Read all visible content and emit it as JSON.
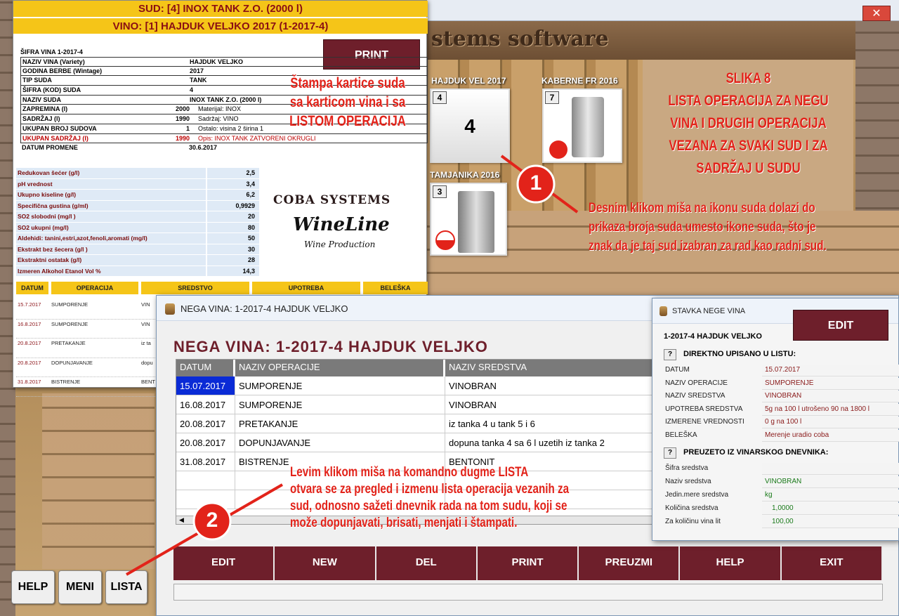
{
  "app": {
    "banner_text": "stems software"
  },
  "tiles": [
    {
      "label": "HAJDUK VEL 2017",
      "number": "4",
      "center_number": "4"
    },
    {
      "label": "KABERNE FR 2016",
      "number": "7"
    },
    {
      "label": "TAMJANIKA  2016",
      "number": "3"
    }
  ],
  "annotation": {
    "slika_title": "SLIKA 8",
    "slika_lines": [
      "LISTA OPERACIJA ZA NEGU",
      "VINA I DRUGIH OPERACIJA",
      "VEZANA ZA SVAKI SUD I ZA",
      "SADRŽAJ U SUDU"
    ],
    "print_note_lines": [
      "Štampa kartice suda",
      "sa karticom vina i sa",
      "LISTOM OPERACIJA"
    ],
    "note1_lines": [
      "Desnim klikom miša na ikonu suda dolazi do",
      "prikaza broja suda umesto ikone suda, što je",
      "znak da je taj sud izabran za rad kao radni sud."
    ],
    "note2_lines": [
      "Levim klikom miša na komandno dugme LISTA",
      "otvara se za pregled i izmenu lista operacija vezanih za",
      "sud, odnosno sažeti dnevnik rada na tom sudu, koji se",
      "može dopunjavati, brisati, menjati i štampati."
    ],
    "marker1": "1",
    "marker2": "2"
  },
  "report": {
    "sud_header": "SUD: [4]  INOX TANK Z.O. (2000 l)",
    "vino_header": "VINO: [1]  HAJDUK VELJKO 2017  (1-2017-4)",
    "sifra_vina": "ŠIFRA VINA 1-2017-4",
    "print_button": "PRINT",
    "rows": [
      {
        "label": "NAZIV VINA (Variety)",
        "value": "HAJDUK VELJKO",
        "extra": ""
      },
      {
        "label": "GODINA BERBE (Wintage)",
        "value": "2017",
        "extra": ""
      },
      {
        "label": "TIP SUDA",
        "value": "TANK",
        "extra": ""
      },
      {
        "label": "ŠIFRA (KOD) SUDA",
        "value": "4",
        "extra": ""
      },
      {
        "label": "NAZIV SUDA",
        "value": "INOX TANK Z.O. (2000 l)",
        "extra": ""
      },
      {
        "label": "ZAPREMINA (l)",
        "value": "2000",
        "extra": "Materijal: INOX"
      },
      {
        "label": "SADRŽAJ (l)",
        "value": "1990",
        "extra": "Sadržaj: VINO"
      },
      {
        "label": "UKUPAN BROJ SUDOVA",
        "value": "1",
        "extra": "Ostalo: visina 2 širina 1"
      },
      {
        "label": "UKUPAN SADRŽAJ (l)",
        "value": "1990",
        "extra": "Opis: INOX TANK ZATVORENI OKRUGLI"
      },
      {
        "label": "DATUM PROMENE",
        "value": "30.6.2017",
        "extra": ""
      }
    ],
    "analysis": [
      {
        "label": "Redukovan šećer (g/l)",
        "value": "2,5"
      },
      {
        "label": "pH vrednost",
        "value": "3,4"
      },
      {
        "label": "Ukupno kiseline (g/l)",
        "value": "6,2"
      },
      {
        "label": "Specifična gustina (g/ml)",
        "value": "0,9929"
      },
      {
        "label": "SO2 slobodni (mg/l )",
        "value": "20"
      },
      {
        "label": "SO2 ukupni (mg/l)",
        "value": "80"
      },
      {
        "label": "Aldehidi: tanini,estri,azot,fenoli,aromati (mg/l)",
        "value": "50"
      },
      {
        "label": "Ekstrakt bez šecera (g/l )",
        "value": "30"
      },
      {
        "label": "Ekstraktni ostatak (g/l)",
        "value": "28"
      },
      {
        "label": "Izmeren Alkohol Etanol Vol %",
        "value": "14,3"
      }
    ],
    "logo": {
      "brand": "COBA SYSTEMS",
      "product": "WineLine",
      "tagline": "Wine Production"
    },
    "table_headers": [
      "DATUM",
      "OPERACIJA",
      "SREDSTVO",
      "UPOTREBA",
      "BELEŠKA"
    ],
    "table_rows": [
      {
        "date": "15.7.2017",
        "op": "SUMPORENJE",
        "sredstvo": "VIN"
      },
      {
        "date": "16.8.2017",
        "op": "SUMPORENJE",
        "sredstvo": "VIN"
      },
      {
        "date": "20.8.2017",
        "op": "PRETAKANJE",
        "sredstvo": "iz ta"
      },
      {
        "date": "20.8.2017",
        "op": "DOPUNJAVANJE",
        "sredstvo": "dopu"
      },
      {
        "date": "31.8.2017",
        "op": "BISTRENJE",
        "sredstvo": "BENT"
      }
    ]
  },
  "nega_window": {
    "title": "NEGA VINA: 1-2017-4 HAJDUK VELJKO",
    "heading": "NEGA VINA: 1-2017-4 HAJDUK VELJKO",
    "columns": [
      "DATUM",
      "NAZIV OPERACIJE",
      "NAZIV SREDSTVA"
    ],
    "rows": [
      {
        "date": "15.07.2017",
        "op": "SUMPORENJE",
        "sredstvo": "VINOBRAN"
      },
      {
        "date": "16.08.2017",
        "op": "SUMPORENJE",
        "sredstvo": "VINOBRAN"
      },
      {
        "date": "20.08.2017",
        "op": "PRETAKANJE",
        "sredstvo": "iz tanka 4 u tank 5 i 6"
      },
      {
        "date": "20.08.2017",
        "op": "DOPUNJAVANJE",
        "sredstvo": "dopuna tanka 4 sa 6 l uzetih iz tanka 2"
      },
      {
        "date": "31.08.2017",
        "op": "BISTRENJE",
        "sredstvo": "BENTONIT"
      }
    ],
    "buttons": [
      "EDIT",
      "NEW",
      "DEL",
      "PRINT",
      "PREUZMI",
      "HELP",
      "EXIT"
    ]
  },
  "stavka_window": {
    "title": "STAVKA NEGE VINA",
    "subtitle": "1-2017-4 HAJDUK VELJKO",
    "edit_button": "EDIT",
    "section1": "DIREKTNO UPISANO U LISTU:",
    "q": "?",
    "fields1": [
      {
        "label": "DATUM",
        "value": "15.07.2017"
      },
      {
        "label": "NAZIV OPERACIJE",
        "value": "SUMPORENJE"
      },
      {
        "label": "NAZIV SREDSTVA",
        "value": "VINOBRAN"
      },
      {
        "label": "UPOTREBA SREDSTVA",
        "value": "5g na 100 l  utrošeno 90 na 1800 l"
      },
      {
        "label": "IZMERENE VREDNOSTI",
        "value": "0 g na 100 l"
      },
      {
        "label": "BELEŠKA",
        "value": "Merenje uradio coba"
      }
    ],
    "section2": "PREUZETO IZ VINARSKOG DNEVNIKA:",
    "fields2": [
      {
        "label": "Šifra sredstva",
        "value": ""
      },
      {
        "label": "Naziv sredstva",
        "value": "VINOBRAN"
      },
      {
        "label": "Jedin.mere sredstva",
        "value": "kg"
      },
      {
        "label": "Količina sredstva",
        "value": "1,0000"
      },
      {
        "label": "Za količinu vina lit",
        "value": "100,00"
      }
    ]
  },
  "bottom_buttons": [
    "HELP",
    "MENI",
    "LISTA"
  ],
  "colors": {
    "accent": "#6e1f2b",
    "annotation": "#e2231a",
    "report_yellow": "#f5c518"
  }
}
